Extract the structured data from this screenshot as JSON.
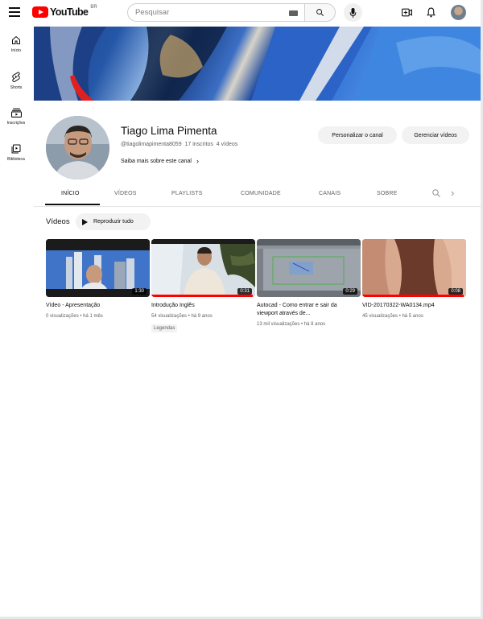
{
  "topbar": {
    "logo_text": "YouTube",
    "logo_country": "BR",
    "search_placeholder": "Pesquisar",
    "icons": [
      "menu-icon",
      "keyboard-icon",
      "search-icon",
      "mic-icon",
      "create-icon",
      "bell-icon",
      "avatar"
    ]
  },
  "rail": {
    "items": [
      {
        "label": "Início",
        "icon": "home-icon"
      },
      {
        "label": "Shorts",
        "icon": "shorts-icon"
      },
      {
        "label": "Inscrições",
        "icon": "subscriptions-icon"
      },
      {
        "label": "Biblioteca",
        "icon": "library-icon"
      }
    ]
  },
  "channel": {
    "name": "Tiago Lima Pimenta",
    "handle": "@tiagolimapimenta8059",
    "subscribers": "17 inscritos",
    "videos_count": "4 vídeos",
    "more_label": "Saiba mais sobre este canal",
    "customize_label": "Personalizar o canal",
    "manage_label": "Gerenciar vídeos"
  },
  "tabs": {
    "items": [
      "INÍCIO",
      "VÍDEOS",
      "PLAYLISTS",
      "COMUNIDADE",
      "CANAIS",
      "SOBRE"
    ],
    "active": "INÍCIO"
  },
  "videos_section": {
    "title": "Vídeos",
    "play_all_label": "Reproduzir tudo"
  },
  "videos": [
    {
      "title": "Vídeo - Apresentação",
      "meta": "0 visualizações • há 1 mês",
      "duration": "1:30",
      "progress": 0,
      "badge": ""
    },
    {
      "title": "Introdução Inglês",
      "meta": "54 visualizações • há 9 anos",
      "duration": "0:31",
      "progress": 0.98,
      "badge": "Legendas"
    },
    {
      "title": "Autocad - Como entrar e sair da viewport através de...",
      "meta": "13 mil visualizações • há 8 anos",
      "duration": "0:29",
      "progress": 0,
      "badge": ""
    },
    {
      "title": "VID-20170322-WA0134.mp4",
      "meta": "45 visualizações • há 5 anos",
      "duration": "0:08",
      "progress": 0.98,
      "badge": ""
    }
  ],
  "colors": {
    "brand_red": "#ff0000",
    "text_primary": "#0f0f0f",
    "text_secondary": "#606060",
    "pill_bg": "#f2f2f2"
  }
}
